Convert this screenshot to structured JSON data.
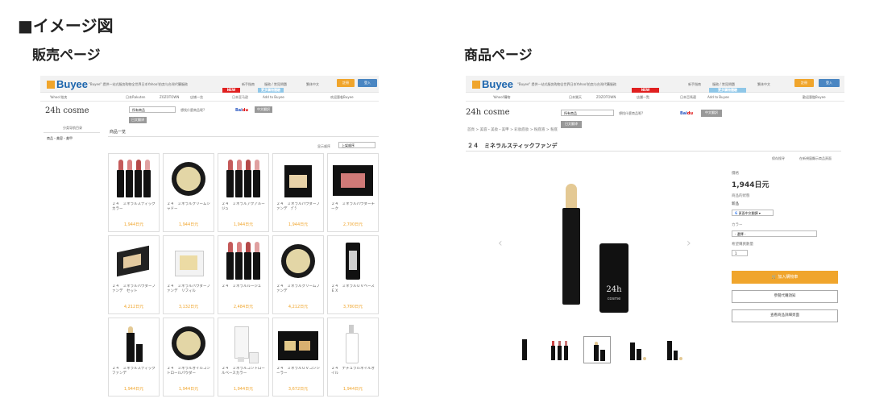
{
  "page": {
    "heading": "■イメージ図",
    "left_caption": "販売ページ",
    "right_caption": "商品ページ"
  },
  "site": {
    "logo": "Buyee",
    "tagline": "\"Buyee\" 提供一站式服务购物全世界日本Yahoo!拍卖与台灣代購服務",
    "links": [
      "新手指南",
      "服務 / 常見問題",
      "繁体中文"
    ],
    "login": "註冊",
    "enter": "登入",
    "new_badge": "NEW",
    "sub_badge": "更多購物體驗",
    "nav_left": [
      "Yahoo!拍卖",
      "日本Rakuten",
      "ZOZOTOWN",
      "店铺一览",
      "日本亚马逊",
      "Add to Buyee"
    ],
    "nav_right": [
      "欢迎惠临Buyee"
    ],
    "nav_right_product": "歡迎惠臨Buyee",
    "nav_product": [
      "Yahoo!購物",
      "日本樂天",
      "ZOZOTOWN",
      "店舖一覧",
      "日本亞馬遜",
      "Add to Buyee"
    ],
    "accent": "#f0a52c",
    "brand_blue": "#1c65ad"
  },
  "store": {
    "logo": "24h cosme",
    "search_select": "所有商品",
    "search_placeholder": "想找什麼商品呢?",
    "search_btn": "中文翻訳",
    "sub_btn": "日文翻译",
    "baidu": "Bai",
    "baidu_suffix": "du"
  },
  "listing": {
    "side_title": "分类导航目录",
    "side_item": "商品・美容・美甲",
    "section_title": "商品一览",
    "sort_label": "显示顺序",
    "sort_value": "上架顺序",
    "products": [
      {
        "name": "２４　ミネラルスティックカラー",
        "price": "1,944日元",
        "icon": "lipstick-set"
      },
      {
        "name": "２４　ミネラルクリームシャドー",
        "price": "1,944日元",
        "icon": "cream-compact"
      },
      {
        "name": "２４　ミネラルアクアルージュ",
        "price": "1,944日元",
        "icon": "lipstick-set"
      },
      {
        "name": "２４　ミネラルパウダーファンデ　ﾌﾟﾗ",
        "price": "1,944日元",
        "icon": "powder-palette"
      },
      {
        "name": "２４　ミネラルパウダーチーク",
        "price": "2,700日元",
        "icon": "cheek-palette"
      },
      {
        "name": "２４　ミネラルパウダーファンデ　セット",
        "price": "4,212日元",
        "icon": "compact-set"
      },
      {
        "name": "２４　ミネラルパウダーファンデ　リフィル",
        "price": "3,132日元",
        "icon": "refill"
      },
      {
        "name": "２４　ミネラルルージュ",
        "price": "2,484日元",
        "icon": "lipstick-set"
      },
      {
        "name": "２４　ミネラルクリームファンデ",
        "price": "4,212日元",
        "icon": "cream-compact"
      },
      {
        "name": "２４　ミネラルＵＶベースＥＸ",
        "price": "3,780日元",
        "icon": "uv-bottle"
      },
      {
        "name": "２４　ミネラルスティックファンデ",
        "price": "1,944日元",
        "icon": "stick"
      },
      {
        "name": "２４　ミネラルオイルコントロールパウダー",
        "price": "1,944日元",
        "icon": "cream-compact"
      },
      {
        "name": "２４　ミネラルコントロールベースカラー",
        "price": "1,944日元",
        "icon": "tube"
      },
      {
        "name": "２４　ミネラルＵＶコンシーラー",
        "price": "3,672日元",
        "icon": "concealer-palette"
      },
      {
        "name": "２４　ナチュラルネイルオイル",
        "price": "1,944日元",
        "icon": "nail-oil"
      }
    ]
  },
  "product": {
    "breadcrumb": [
      "首頁",
      "美容・美妝・美甲",
      "彩妝底妝",
      "粉底液",
      "粉底"
    ],
    "title": "２４　ミネラルスティックファンデ",
    "toolbar": [
      "保存搜寻",
      "在新視窗顯示商品頁面"
    ],
    "price_label": "價格",
    "price": "1,944日元",
    "state_label": "商品的狀態",
    "state": "新品",
    "translate_btn": "頁面中文翻譯",
    "color_label": "カラー",
    "color_value": "- 選擇 -",
    "qty_label": "希望購買數量",
    "qty": "1",
    "add_cart": "加入購物車",
    "btn_2": "參閱代購須知",
    "btn_3": "查看商品詳細頁面",
    "thumbs": 5,
    "selected_thumb": 3
  }
}
